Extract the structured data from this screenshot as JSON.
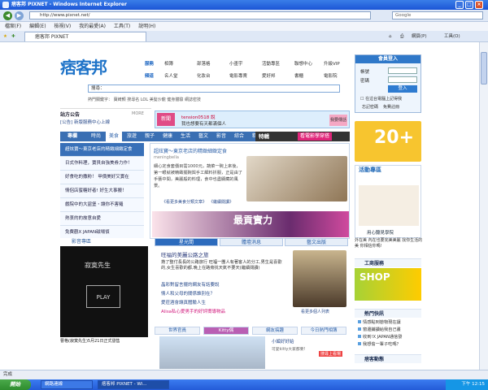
{
  "window": {
    "title": "痞客邦 PIXNET - Windows Internet Explorer",
    "minimize": "_",
    "maximize": "□",
    "close": "×"
  },
  "address": {
    "url": "http://www.pixnet.net/",
    "search_placeholder": "Google"
  },
  "menu": [
    "檔案(F)",
    "編輯(E)",
    "檢視(V)",
    "我的最愛(A)",
    "工具(T)",
    "說明(H)"
  ],
  "tab": {
    "label": "痞客邦 PIXNET"
  },
  "toolbar": {
    "page": "網頁(P)",
    "tools": "工具(O)"
  },
  "site": {
    "logo": "痞客邦",
    "nav": {
      "services_label": "服務",
      "services": [
        "相簿",
        "部落格",
        "小墨宇",
        "活動專區",
        "聯想中心",
        "升級VIP"
      ],
      "channels_label": "頻道",
      "channels": [
        "名人堂",
        "化妝台",
        "電影專賣",
        "愛好邦",
        "書櫃",
        "電影院"
      ]
    },
    "search_placeholder": "搜尋：",
    "search_button": "搜尋",
    "hot_keywords_label": "熱門關鍵字：",
    "hot_keywords": [
      "寶綺顏",
      "搜尋名",
      "LOL",
      "美髮沙龍",
      "健身體驗",
      "網誌密技"
    ],
    "login": {
      "title": "會員登入",
      "account": "帳號",
      "password": "密碼",
      "button": "登入",
      "remember": "在這台電腦上記得我",
      "forgot": "忘記密碼",
      "register": "免費註冊"
    },
    "announcement": {
      "title": "站方公告",
      "more": "MORE",
      "item": "[公告] 新版服務中心上線"
    },
    "banner": {
      "user": "tension0518 說",
      "text": "我也想要有天都滿個人",
      "tag": "新聞",
      "btn": "我要傳話"
    },
    "top_nav": [
      "專欄",
      "時尚",
      "美食",
      "旅遊",
      "親子",
      "健康",
      "生活",
      "藝文",
      "影音",
      "綜合",
      "精選"
    ],
    "special_label": "特輯",
    "special_title": "看電影學穿搭",
    "left_list": [
      "超炫寶～東京老店的精緻細緻定食",
      "日式作料理，寶貝自強美券力作！",
      "好食吃的撒粉！ 甲價美好又實在",
      "情侶店蜜糖好者! 好生大事搬！",
      "戲院中的大盜堡・讓你不害羅",
      "熱衷的的故意自愛",
      "免費觀X JAPAN磁場偵"
    ],
    "feature": {
      "title": "超炫寶～東京老店的精緻細緻定食",
      "author": "meningbella",
      "text": "細心定食套價目需1000元，蔬菜一碗上來後，第一眼就被精緻擺碗與手工細料折服，正是由了手藝中間，美麗般的料理，食中也盡顯藏的風景。",
      "link": "《看更多美食分類文章》",
      "link2": "《繼續閱讀》",
      "banner_text": "最貢實力"
    },
    "video": {
      "title": "影音專區",
      "name": "寂寞先生",
      "play": "PLAY",
      "caption": "曹格(寂寞先生)5月21日正式發售"
    },
    "mid_tabs": [
      "星光間",
      "體壇消息",
      "藝文出版"
    ],
    "mid": {
      "title": "旺福的美麗公路之旅",
      "text": "揹了整付長長的公路旅行 旺福一團人有著客人的分工,男生是喜歡的,女生喜歡的都,晚上在路旁找天氣不要天(繼續閱讀)",
      "links": [
        "晶彩對留言擺的網友有話要說",
        "情人和父母的關係誰別在？",
        "愛莊酒會讓真體驗人生",
        "Alisa私心愛男手的好評嚮導物品"
      ],
      "photo_link": "看更多個人列表"
    },
    "bottom_tabs": [
      "世界官員",
      "Kitty偶",
      "網友搞趣",
      "今日熱門相簿"
    ],
    "bottom_links": [
      "小編好好給",
      "可愛kitty大家都要!",
      "搜尋上看場"
    ],
    "right_badge": "20+",
    "activity": {
      "title": "活動專區",
      "caption": "用心聽見學院"
    },
    "right_text": "外在美 內在也要完美美麗 找你生活的美 你相信你嗎!",
    "sections": [
      {
        "title": "工商服務"
      },
      {
        "title": "熱門快訊",
        "items": [
          "情感點到戀物現在讓",
          "窗邊鋪讀給我自己畫",
          "收到!X JAPAN通信發",
          "我想偷一輩子吃嗎？"
        ]
      },
      {
        "title": "痞客動態"
      }
    ],
    "shop_text": "SHOP"
  },
  "status": {
    "text": "完成"
  },
  "taskbar": {
    "start": "開始",
    "tasks": [
      "網路連線",
      "痞客邦 PIXNET - Wi..."
    ],
    "clock": "下午 12:15"
  }
}
